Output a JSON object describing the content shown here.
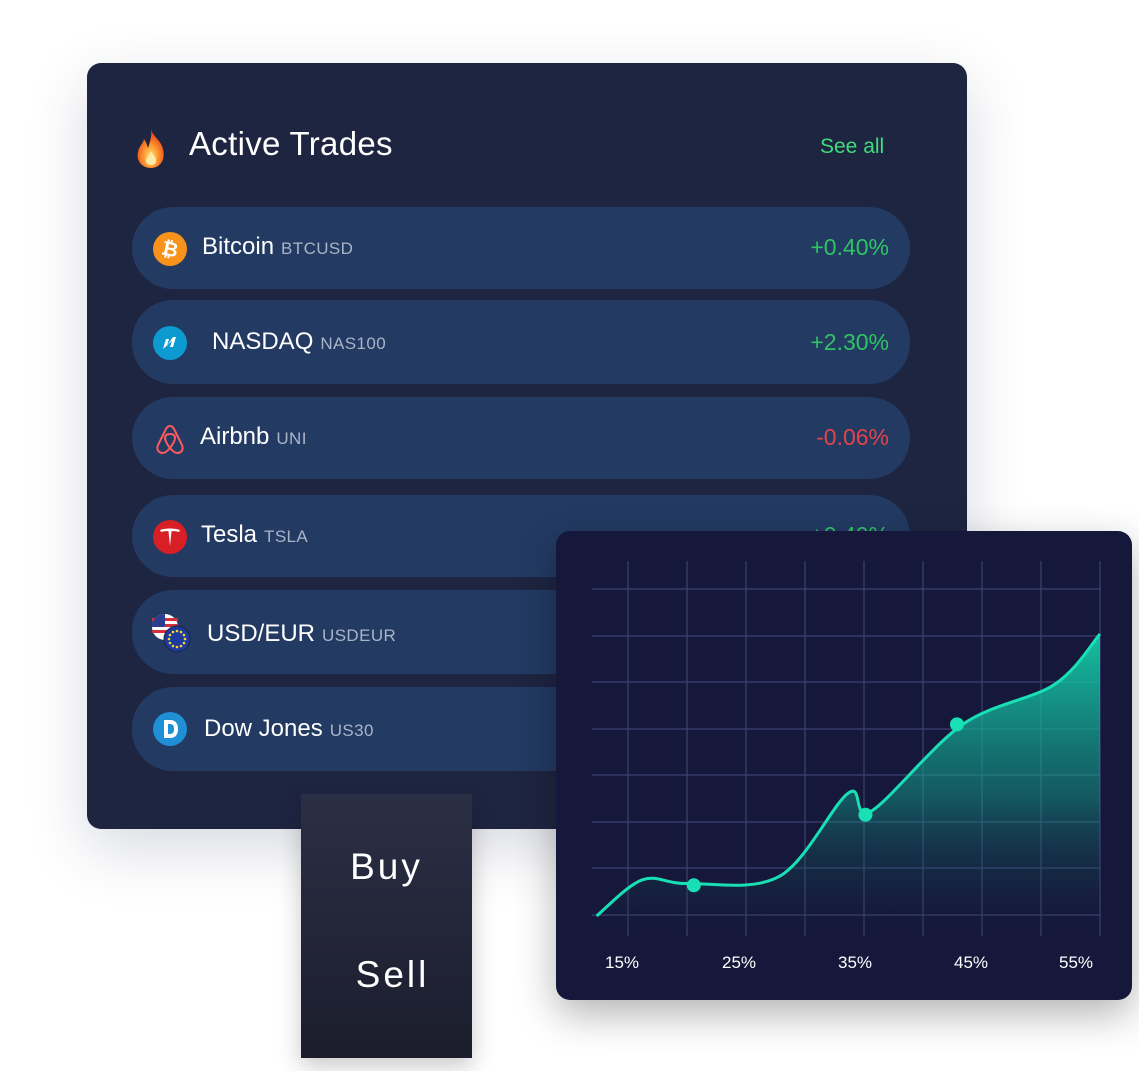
{
  "header": {
    "title": "Active Trades",
    "title_icon": "fire-icon",
    "see_all": "See all"
  },
  "trades": [
    {
      "name": "Bitcoin",
      "ticker": "BTCUSD",
      "change": "+0.40%",
      "icon": "bitcoin-icon",
      "direction": "up"
    },
    {
      "name": "NASDAQ",
      "ticker": "NAS100",
      "change": "+2.30%",
      "icon": "nasdaq-icon",
      "direction": "up"
    },
    {
      "name": "Airbnb",
      "ticker": "UNI",
      "change": "-0.06%",
      "icon": "airbnb-icon",
      "direction": "down"
    },
    {
      "name": "Tesla",
      "ticker": "TSLA",
      "change": "+0.40%",
      "icon": "tesla-icon",
      "direction": "up"
    },
    {
      "name": "USD/EUR",
      "ticker": "USDEUR",
      "change": "",
      "icon": "usd-eur-flags-icon",
      "direction": "up"
    },
    {
      "name": "Dow Jones",
      "ticker": "US30",
      "change": "",
      "icon": "dow-jones-icon",
      "direction": "up"
    }
  ],
  "actions": {
    "buy": "Buy",
    "sell": "Sell"
  },
  "colors": {
    "card_bg": "#1e2541",
    "row_bg": "#233a63",
    "positive": "#2fc463",
    "negative": "#e2444b",
    "accent": "#3fdc7c",
    "chart_line": "#19e0b4",
    "chart_bg": "#15183a"
  },
  "chart_data": {
    "type": "area",
    "title": "",
    "xlabel": "",
    "ylabel": "",
    "x_tick_labels": [
      "15%",
      "25%",
      "35%",
      "45%",
      "55%"
    ],
    "x": [
      0.12,
      0.16,
      0.2,
      0.28,
      0.34,
      0.36,
      0.44,
      0.52,
      0.56
    ],
    "values": [
      0.0,
      0.1,
      0.09,
      0.11,
      0.34,
      0.29,
      0.53,
      0.64,
      0.78
    ],
    "highlighted_points": [
      {
        "x": 0.205,
        "y": 0.085
      },
      {
        "x": 0.355,
        "y": 0.28
      },
      {
        "x": 0.435,
        "y": 0.53
      }
    ],
    "grid": true,
    "series": [
      {
        "values": [
          0.0,
          0.1,
          0.09,
          0.11,
          0.34,
          0.29,
          0.53,
          0.64,
          0.78
        ]
      }
    ]
  }
}
